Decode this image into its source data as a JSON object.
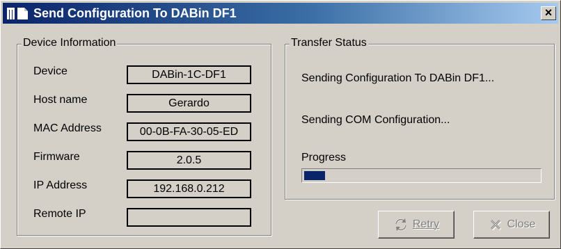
{
  "window": {
    "title": "Send Configuration To DABin DF1",
    "close_glyph": "×",
    "title_icon": "app-window-icon"
  },
  "device_info": {
    "legend": "Device Information",
    "rows": [
      {
        "label": "Device",
        "value": "DABin-1C-DF1"
      },
      {
        "label": "Host name",
        "value": "Gerardo"
      },
      {
        "label": "MAC Address",
        "value": "00-0B-FA-30-05-ED"
      },
      {
        "label": "Firmware",
        "value": "2.0.5"
      },
      {
        "label": "IP Address",
        "value": "192.168.0.212"
      },
      {
        "label": "Remote IP",
        "value": ""
      }
    ]
  },
  "transfer_status": {
    "legend": "Transfer Status",
    "line1": "Sending Configuration To DABin DF1...",
    "line2": "Sending COM Configuration...",
    "progress_label": "Progress",
    "progress_fraction": 0.09
  },
  "buttons": {
    "retry": {
      "label": "Retry",
      "accelerator": "R",
      "icon": "refresh-icon",
      "enabled": false
    },
    "close": {
      "label": "Close",
      "icon": "close-x-icon",
      "enabled": false
    }
  },
  "colors": {
    "titlebar_start": "#0a246a",
    "titlebar_end": "#a6caf0",
    "dialog_bg": "#d4d0c8",
    "progress_fill": "#0a246a",
    "disabled_text": "#808080"
  }
}
